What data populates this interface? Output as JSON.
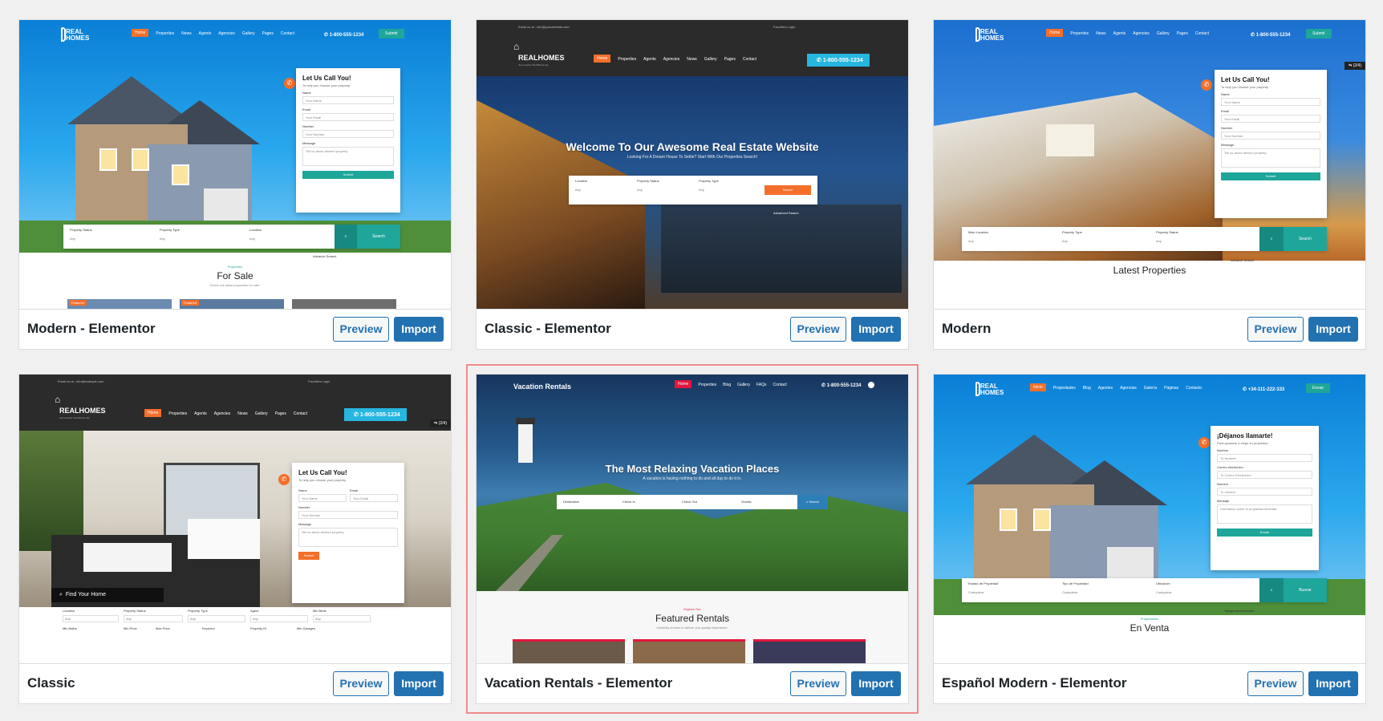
{
  "cards": [
    {
      "title": "Modern - Elementor",
      "preview_label": "Preview",
      "import_label": "Import",
      "thumb": {
        "logo": "REAL HOMES",
        "nav": [
          "Home",
          "Properties",
          "News",
          "Agents",
          "Agencies",
          "Gallery",
          "Pages",
          "Contact"
        ],
        "phone": "1-800-555-1234",
        "submit": "Submit",
        "form": {
          "title": "Let Us Call You!",
          "subtitle": "To help you choose your property",
          "name_label": "Name",
          "name_ph": "Your Name",
          "email_label": "Email",
          "email_ph": "Your Email",
          "number_label": "Number",
          "number_ph": "Your Number",
          "message_label": "Message",
          "message_ph": "Tell us about desired property",
          "submit": "Submit"
        },
        "search": {
          "f1_label": "Property Status",
          "f1_value": "Any",
          "f2_label": "Property Type",
          "f2_value": "Any",
          "f3_label": "Location",
          "f3_value": "Any",
          "search": "Search",
          "advance": "Advance Search"
        },
        "section_small": "Properties",
        "section_head": "For Sale",
        "section_desc": "Check out latest properties for sale.",
        "badge": "Featured"
      }
    },
    {
      "title": "Classic - Elementor",
      "preview_label": "Preview",
      "import_label": "Import",
      "thumb": {
        "topbar": "Email us at : info@yourwebsite.com",
        "topbar_right": "Favorites    Login",
        "logo": "REALHOMES",
        "tagline": "Just another WordPress site",
        "nav": [
          "Home",
          "Properties",
          "Agents",
          "Agencies",
          "News",
          "Gallery",
          "Pages",
          "Contact"
        ],
        "phone": "1-800-555-1234",
        "hero_title": "Welcome To Our Awesome Real Estate Website",
        "hero_sub": "Looking For A Dream House To Settle? Start With Our Properties Search!",
        "search": {
          "f1_label": "Location",
          "f1_value": "Any",
          "f2_label": "Property Status",
          "f2_value": "Any",
          "f3_label": "Property Type",
          "f3_value": "Any",
          "search": "Search",
          "advance": "Advanced Search"
        }
      }
    },
    {
      "title": "Modern",
      "preview_label": "Preview",
      "import_label": "Import",
      "thumb": {
        "logo": "REAL HOMES",
        "nav": [
          "Home",
          "Properties",
          "News",
          "Agents",
          "Agencies",
          "Gallery",
          "Pages",
          "Contact"
        ],
        "phone": "1-800-555-1234",
        "submit": "Submit",
        "counter": "(2/4)",
        "form": {
          "title": "Let Us Call You!",
          "subtitle": "To help you choose your property",
          "name_label": "Name",
          "name_ph": "Your Name",
          "email_label": "Email",
          "email_ph": "Your Email",
          "number_label": "Number",
          "number_ph": "Your Number",
          "message_label": "Message",
          "message_ph": "Tell us about desired property",
          "submit": "Submit"
        },
        "search": {
          "f1_label": "Main Location",
          "f1_value": "Any",
          "f2_label": "Property Type",
          "f2_value": "Any",
          "f3_label": "Property Status",
          "f3_value": "Any",
          "search": "Search",
          "advance": "Advance Search"
        },
        "section_head": "Latest Properties"
      }
    },
    {
      "title": "Classic",
      "preview_label": "Preview",
      "import_label": "Import",
      "thumb": {
        "topbar": "Email us at : info@example.com",
        "topbar_right": "Favorites    Login",
        "logo": "REALHOMES",
        "tagline": "Just another WordPress site",
        "nav": [
          "Home",
          "Properties",
          "Agents",
          "Agencies",
          "News",
          "Gallery",
          "Pages",
          "Contact"
        ],
        "phone": "1-800-555-1234",
        "counter": "(2/4)",
        "find_home": "Find Your Home",
        "form": {
          "title": "Let Us Call You!",
          "subtitle": "To help you choose your property",
          "name_label": "Name",
          "name_ph": "Your Name",
          "email_label": "Email",
          "email_ph": "Your Email",
          "number_label": "Number",
          "number_ph": "Your Number",
          "message_label": "Message",
          "message_ph": "Tell us about desired property",
          "submit": "Submit"
        },
        "filters_row1": [
          "Location",
          "Property Status",
          "Property Type",
          "Agent",
          "Min Beds"
        ],
        "filters_row2": [
          "Min Baths",
          "Min Price",
          "Max Price",
          "Keyword",
          "Property ID",
          "Min Garages"
        ],
        "any": "Any"
      }
    },
    {
      "title": "Vacation Rentals - Elementor",
      "preview_label": "Preview",
      "import_label": "Import",
      "thumb": {
        "logo": "Vacation Rentals",
        "nav": [
          "Home",
          "Properties",
          "Blog",
          "Gallery",
          "FAQs",
          "Contact"
        ],
        "phone": "1-800-555-1234",
        "hero_title": "The Most Relaxing Vacation Places",
        "hero_sub": "A vacation is having nothing to do and all day to do it in.",
        "search": {
          "f1": "Destination",
          "f2": "Check In",
          "f3": "Check Out",
          "f4": "Guests",
          "search": "Search"
        },
        "section_small": "Explore Our",
        "section_head": "Featured Rentals",
        "section_desc": "Carefully chosen to deliver you quality experience."
      }
    },
    {
      "title": "Español Modern - Elementor",
      "preview_label": "Preview",
      "import_label": "Import",
      "thumb": {
        "logo": "REAL HOMES",
        "nav": [
          "Inicio",
          "Propiedades",
          "Blog",
          "Agentes",
          "Agencias",
          "Galería",
          "Páginas",
          "Contacto"
        ],
        "phone": "+34-111-222-333",
        "submit": "Enviar",
        "form": {
          "title": "¡Déjanos llamarte!",
          "subtitle": "Para ayudarte a elegir su propiedad",
          "name_label": "Nombre",
          "name_ph": "Tu Nombre",
          "email_label": "Correo electrónico",
          "email_ph": "Tu Correo Electrónico",
          "number_label": "Número",
          "number_ph": "Tu número",
          "message_label": "Mensaje",
          "message_ph": "Cuéntanos sobre tu propiedad deseada",
          "submit": "Enviar"
        },
        "search": {
          "f1_label": "Estado de Propiedad",
          "f1_value": "Cualquiera",
          "f2_label": "Tipo de Propiedad",
          "f2_value": "Cualquiera",
          "f3_label": "Ubicación",
          "f3_value": "Cualquiera",
          "search": "Buscar",
          "advance": "Búsqueda Avanzada"
        },
        "section_small": "Propiedades",
        "section_head": "En Venta"
      }
    }
  ],
  "colors": {
    "accent": "#2271b1",
    "selected_outline": "#f08a8a",
    "teal": "#1ea69a",
    "orange": "#f36f2b"
  }
}
